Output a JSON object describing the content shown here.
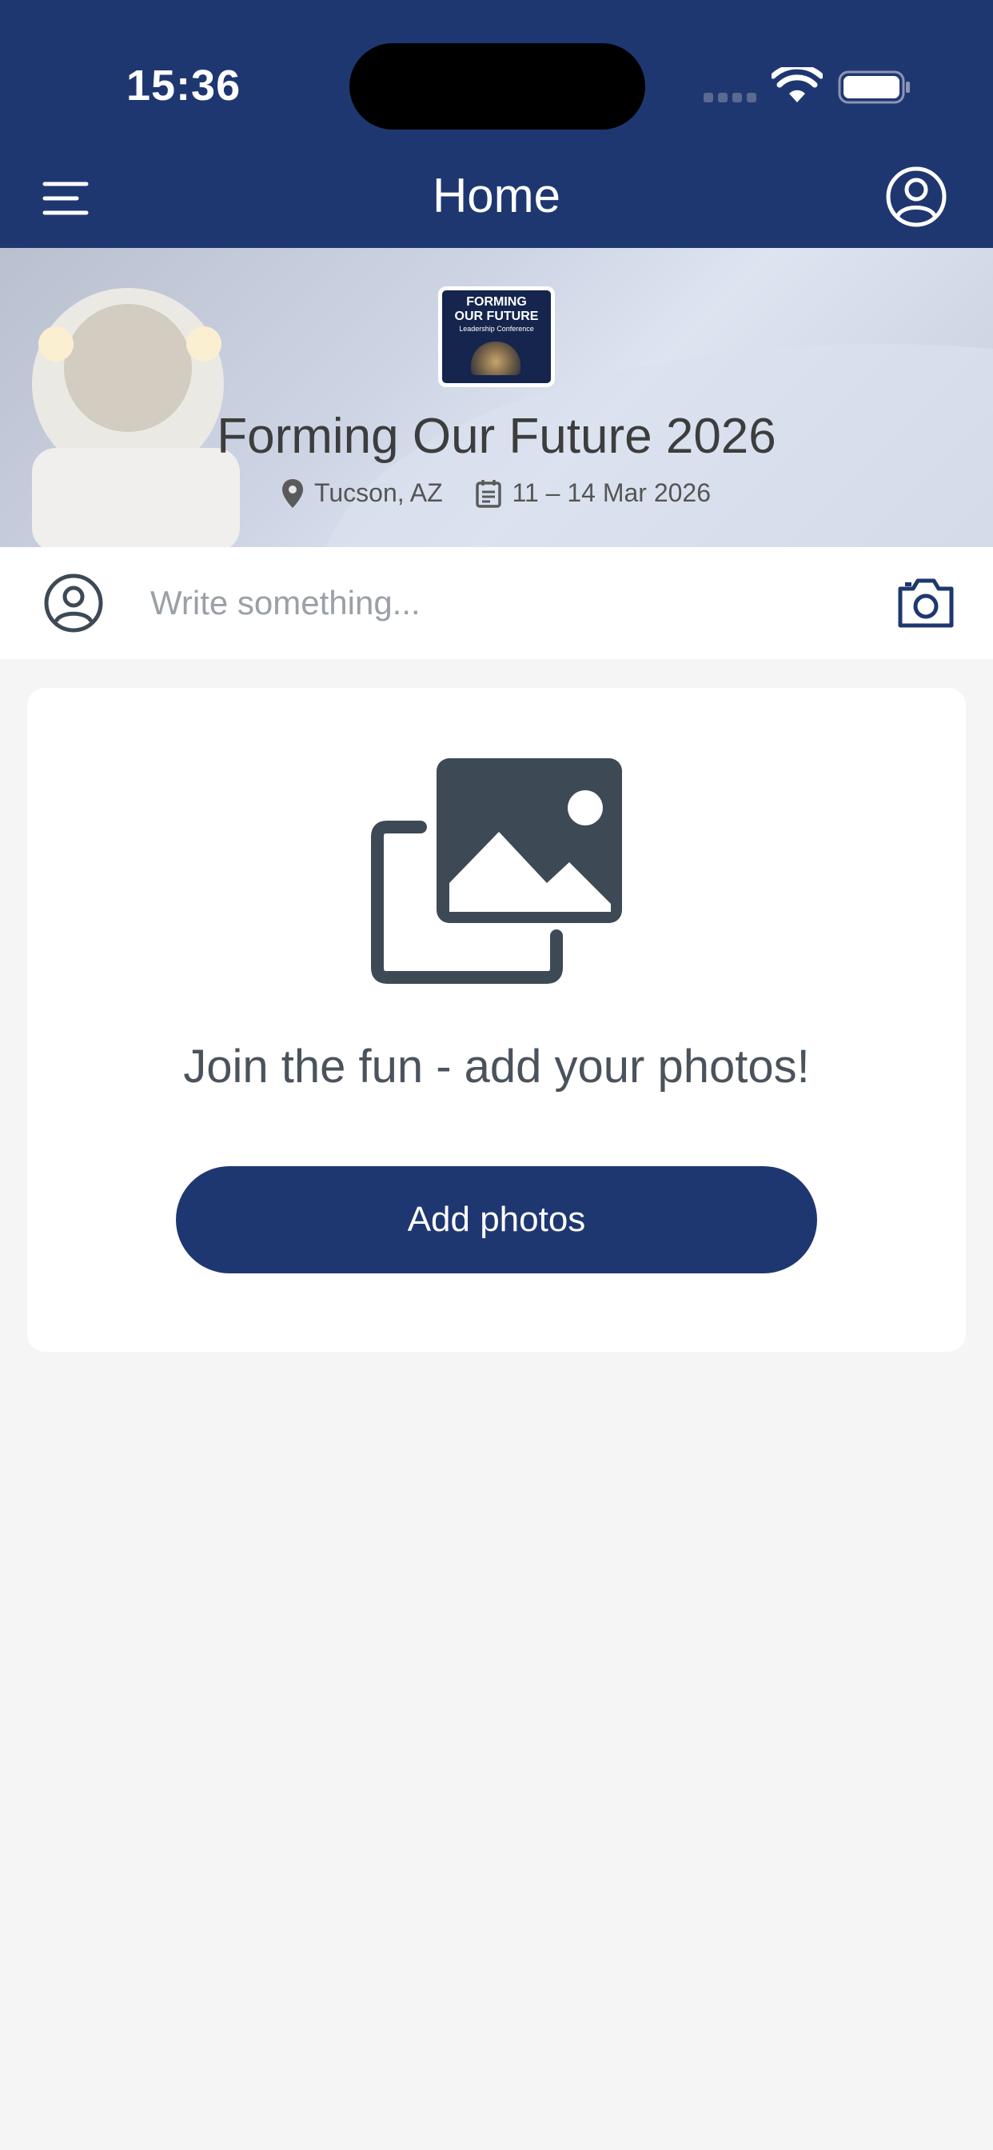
{
  "status_bar": {
    "time": "15:36"
  },
  "nav": {
    "title": "Home",
    "menu_icon": "hamburger-menu-icon",
    "profile_icon": "user-circle-icon"
  },
  "banner": {
    "logo_line1": "FORMING",
    "logo_line2": "OUR FUTURE",
    "logo_line3": "Leadership Conference",
    "title": "Forming Our Future 2026",
    "location": "Tucson, AZ",
    "dates": "11 – 14 Mar 2026"
  },
  "composer": {
    "placeholder": "Write something..."
  },
  "empty_state": {
    "message": "Join the fun - add your photos!",
    "button_label": "Add photos"
  },
  "colors": {
    "brand": "#1f3771",
    "background": "#f5f5f5",
    "icon": "#3d4a55"
  }
}
